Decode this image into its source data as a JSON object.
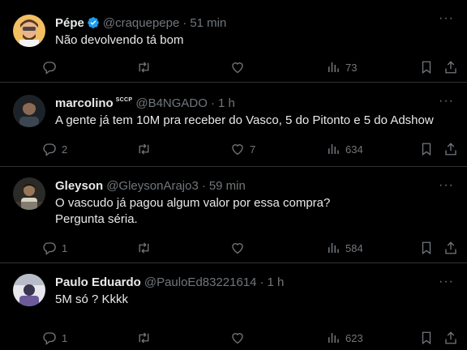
{
  "tweets": [
    {
      "name": "Pépe",
      "handle": "@craquepepe",
      "time": "51 min",
      "text": "Não devolvendo tá bom",
      "replies": "",
      "retweets": "",
      "likes": "",
      "views": "73",
      "verified": true
    },
    {
      "name": "marcolino",
      "badge": "SCCP",
      "handle": "@B4NGADO",
      "time": "1 h",
      "text": "A gente já tem 10M pra receber do Vasco, 5 do Pitonto e 5 do Adshow",
      "replies": "2",
      "retweets": "",
      "likes": "7",
      "views": "634"
    },
    {
      "name": "Gleyson",
      "handle": "@GleysonArajo3",
      "time": "59 min",
      "text": "O vascudo já pagou algum valor por essa compra?\nPergunta séria.",
      "replies": "1",
      "retweets": "",
      "likes": "",
      "views": "584"
    },
    {
      "name": "Paulo Eduardo",
      "handle": "@PauloEd83221614",
      "time": "1 h",
      "text": "5M só ? Kkkk",
      "replies": "1",
      "retweets": "",
      "likes": "",
      "views": "623"
    }
  ],
  "separator": "·",
  "more_glyph": "···",
  "colors": {
    "background": "#000000",
    "text": "#e7e9ea",
    "muted": "#71767b",
    "border": "#2f3336",
    "verified": "#1d9bf0"
  }
}
